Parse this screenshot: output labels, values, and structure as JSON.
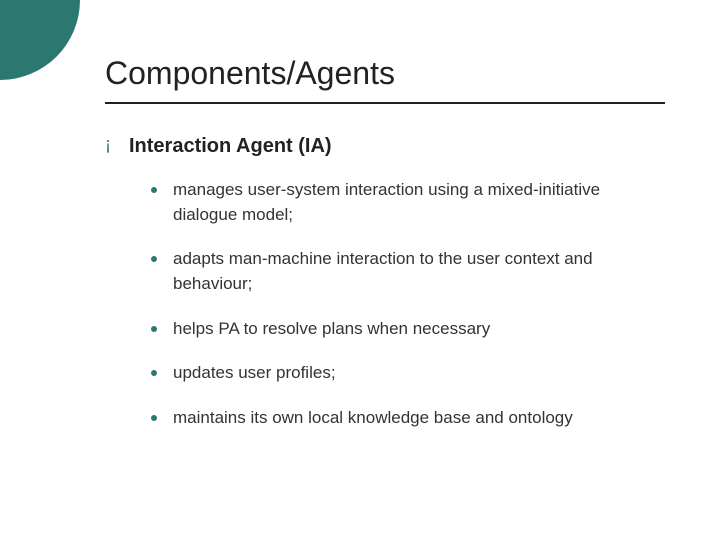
{
  "title": "Components/Agents",
  "heading": "Interaction Agent (IA)",
  "bullets": {
    "lvl1_glyph": "¡"
  },
  "items": [
    "manages user-system interaction using a mixed-initiative dialogue model;",
    "adapts man-machine interaction to the user context and behaviour;",
    "helps PA to resolve plans when necessary",
    "updates user profiles;",
    "maintains its own local knowledge base and ontology"
  ],
  "colors": {
    "accent": "#2b7872",
    "text": "#333333"
  }
}
